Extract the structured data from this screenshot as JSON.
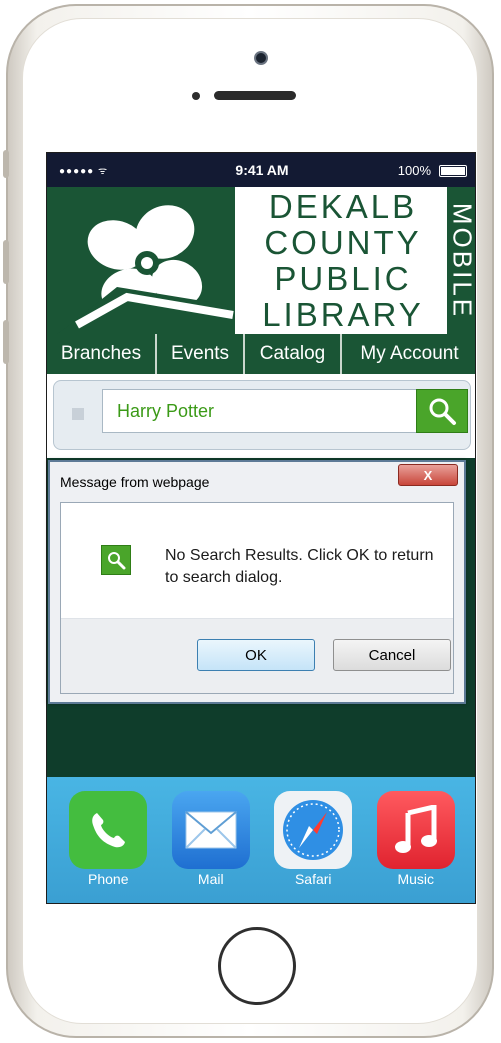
{
  "status_bar": {
    "signal": "●●●●● ᯤ",
    "time": "9:41 AM",
    "battery": "100%"
  },
  "logo": {
    "line1": "DEKALB",
    "line2": "COUNTY",
    "line3": "PUBLIC",
    "line4": "LIBRARY",
    "tagline": "MOBILE"
  },
  "nav": {
    "tabs": [
      {
        "label": "Branches"
      },
      {
        "label": "Events"
      },
      {
        "label": "Catalog"
      },
      {
        "label": "My Account"
      }
    ]
  },
  "search": {
    "value": "Harry Potter",
    "button_icon": "search-icon"
  },
  "dialog": {
    "title": "Message from webpage",
    "close_label": "X",
    "message": "No Search Results. Click OK to return to search dialog.",
    "ok_label": "OK",
    "cancel_label": "Cancel"
  },
  "dock": {
    "apps": [
      {
        "label": "Phone",
        "icon": "phone-icon",
        "color": "#44bd3f"
      },
      {
        "label": "Mail",
        "icon": "mail-icon",
        "color": "#1f7fd8"
      },
      {
        "label": "Safari",
        "icon": "safari-icon",
        "color": "#e9eef3"
      },
      {
        "label": "Music",
        "icon": "music-icon",
        "color": "#f03a4a"
      }
    ]
  },
  "colors": {
    "brand_green": "#1a5535",
    "search_green": "#4aa52a",
    "status_bar": "#131a33"
  }
}
